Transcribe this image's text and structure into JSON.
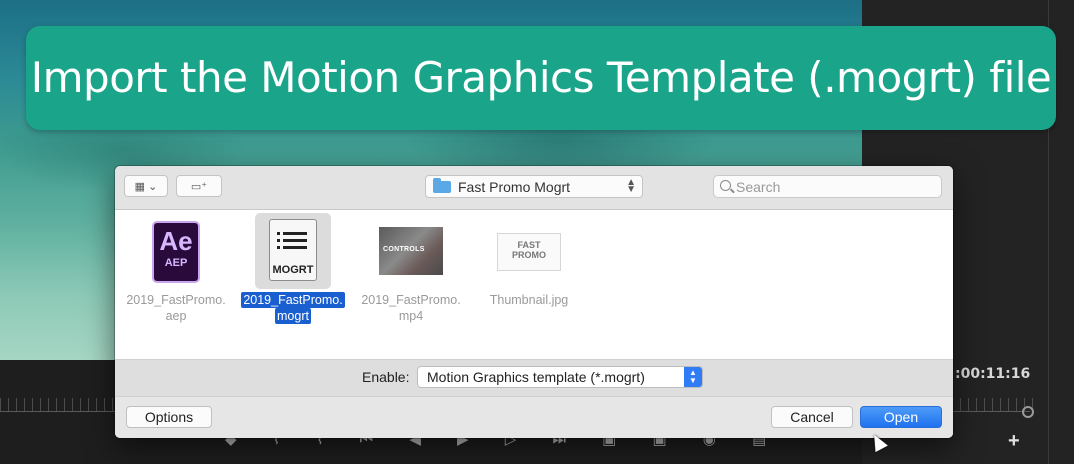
{
  "banner": {
    "title": "Import the Motion Graphics Template (.mogrt) file"
  },
  "timeline": {
    "timecode": ":00:11:16"
  },
  "dialog": {
    "toolbar": {
      "view_icon": "grid-view-icon",
      "new_folder_icon": "new-folder-icon",
      "location": "Fast Promo Mogrt",
      "search_placeholder": "Search"
    },
    "files": [
      {
        "name_line1": "2019_FastPromo.",
        "name_line2": "aep",
        "icon": "after-effects-file-icon",
        "selected": false
      },
      {
        "name_line1": "2019_FastPromo.",
        "name_line2": "mogrt",
        "icon": "mogrt-file-icon",
        "selected": true
      },
      {
        "name_line1": "2019_FastPromo.",
        "name_line2": "mp4",
        "icon": "video-thumbnail",
        "selected": false
      },
      {
        "name_line1": "Thumbnail.jpg",
        "name_line2": "",
        "icon": "image-thumbnail",
        "selected": false
      }
    ],
    "aep_icon": {
      "letters": "Ae",
      "ext": "AEP"
    },
    "mogrt_icon": {
      "label": "MOGRT"
    },
    "mp4_icon": {
      "caption": "CONTROLS"
    },
    "jpg_icon": {
      "line1": "FAST",
      "line2": "PROMO"
    },
    "enable": {
      "label": "Enable:",
      "value": "Motion Graphics template (*.mogrt)"
    },
    "buttons": {
      "options": "Options",
      "cancel": "Cancel",
      "open": "Open"
    }
  },
  "colors": {
    "banner": "#1aa58a",
    "selection": "#1a5fd0",
    "primary_button": "#2f7cf6"
  }
}
